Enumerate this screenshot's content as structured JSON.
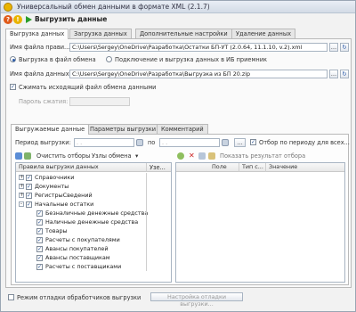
{
  "window": {
    "title": "Универсальный обмен данными в формате XML (2.1.7)"
  },
  "toolbar": {
    "run_label": "Выгрузить данные"
  },
  "main_tabs": [
    {
      "label": "Выгрузка данных"
    },
    {
      "label": "Загрузка данных"
    },
    {
      "label": "Дополнительные настройки"
    },
    {
      "label": "Удаление данных"
    }
  ],
  "rules_file": {
    "label": "Имя файла прави...",
    "value": "C:\\Users\\Sergey\\OneDrive\\Разработка\\Остатки БП-УТ (2.0.64, 11.1.10, v.2).xml"
  },
  "mode": {
    "to_file_label": "Выгрузка в файл обмена",
    "to_ib_label": "Подключение и выгрузка данных в ИБ приемник"
  },
  "data_file": {
    "label": "Имя файла данных:",
    "value": "C:\\Users\\Sergey\\OneDrive\\Разработка\\Выгрузка из БП 20.zip"
  },
  "compress": {
    "label": "Сжимать исходящий файл обмена данными",
    "checked": true
  },
  "password": {
    "label": "Пароль сжатия:"
  },
  "sub_tabs": [
    {
      "label": "Выгружаемые данные"
    },
    {
      "label": "Параметры выгрузки"
    },
    {
      "label": "Комментарий"
    }
  ],
  "period": {
    "label": "Период выгрузки:",
    "from_placeholder": " .  .    ",
    "to_label": "по",
    "to_placeholder": " .  .    ",
    "ellipsis": "...",
    "filter_label": "Отбор по периоду для всех..."
  },
  "rules_toolbar": {
    "clear_filters": "Очистить отборы",
    "exchange_nodes": "Узлы обмена"
  },
  "rules_grid": {
    "col_rules": "Правила выгрузки данных",
    "col_node": "Узе...",
    "rows": [
      {
        "label": "Справочники",
        "level": 0,
        "expander": "+",
        "checked": true
      },
      {
        "label": "Документы",
        "level": 0,
        "expander": "+",
        "checked": true
      },
      {
        "label": "РегистрыСведений",
        "level": 0,
        "expander": "+",
        "checked": true
      },
      {
        "label": "Начальные остатки",
        "level": 0,
        "expander": "-",
        "checked": true
      },
      {
        "label": "Безналичные денежные средства",
        "level": 1,
        "expander": "",
        "checked": true
      },
      {
        "label": "Наличные денежные средства",
        "level": 1,
        "expander": "",
        "checked": true
      },
      {
        "label": "Товары",
        "level": 1,
        "expander": "",
        "checked": true
      },
      {
        "label": "Расчеты с покупателями",
        "level": 1,
        "expander": "",
        "checked": true
      },
      {
        "label": "Авансы покупателей",
        "level": 1,
        "expander": "",
        "checked": true
      },
      {
        "label": "Авансы поставщикам",
        "level": 1,
        "expander": "",
        "checked": true
      },
      {
        "label": "Расчеты с поставщиками",
        "level": 1,
        "expander": "",
        "checked": true
      }
    ]
  },
  "filter_toolbar": {
    "show_result": "Показать результат отбора"
  },
  "filter_grid": {
    "col_field": "Поле",
    "col_type": "Тип с...",
    "col_value": "Значение"
  },
  "debug": {
    "label": "Режим отладки обработчиков выгрузки",
    "button": "Настройка отладки выгрузки..."
  },
  "colors": {
    "accent": "#2a9d2a",
    "help": "#e9b400",
    "question": "#e05a1a"
  }
}
